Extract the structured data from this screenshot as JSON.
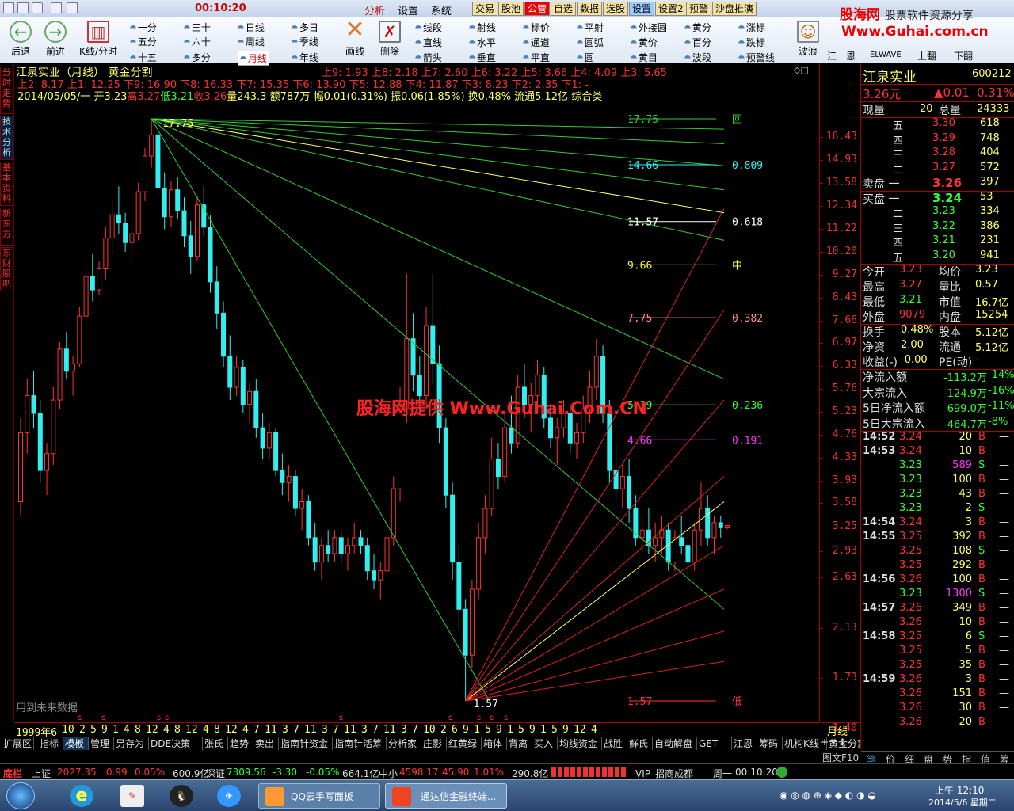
{
  "titlebar": {
    "time": "00:10:20",
    "menus": [
      "分析",
      "设置",
      "系统"
    ],
    "buttons": [
      "交易",
      "股池",
      "公管",
      "自选",
      "数据",
      "选股",
      "设置",
      "设置2",
      "预警",
      "沙盘推演"
    ]
  },
  "toolbar": {
    "nav": [
      "后退",
      "前进",
      "K线/分时"
    ],
    "periods": [
      [
        "一分",
        "三十",
        "日线",
        "多日"
      ],
      [
        "五分",
        "六十",
        "周线",
        "季线"
      ],
      [
        "十五",
        "多分",
        "月线",
        "年线"
      ]
    ],
    "draw_tools": [
      "画线",
      "删除"
    ],
    "shapes": [
      [
        "线段",
        "射线",
        "标价",
        "平射",
        "外接圆",
        "黄分",
        "涨标"
      ],
      [
        "直线",
        "水平",
        "通道",
        "圆弧",
        "黄价",
        "百分",
        "跌标"
      ],
      [
        "箭头",
        "垂直",
        "平直",
        "圆",
        "黄目",
        "波段",
        "预警线"
      ]
    ],
    "extra": [
      "波浪",
      "江",
      "恩",
      "ELWAVE",
      "上翻",
      "下翻"
    ]
  },
  "logo": {
    "line1": "股海网",
    "line1b": "股票软件资源分享",
    "line2": "Www.Guhai.com.cn"
  },
  "side_tabs": [
    "分时走势",
    "技术分析",
    "基本资料",
    "新东方",
    "东财股吧"
  ],
  "chart": {
    "title": "江泉实业（月线）  黄金分割",
    "line1": "上9: 1.93 上8: 2.18 上7: 2.60 上6: 3.22 上5: 3.66 上4: 4.09 上3: 5.65",
    "line2": "上2: 8.17 上1: 12.25 下9: 16.90 下8: 16.33 下7: 15.35 下6: 13.90 下5: 12.88 下4: 11.87 下3: 8.23 下2: 2.35 下1: -",
    "line3_date": "2014/05/05/一",
    "line3_open": "开3.23",
    "line3_high": "高3.27",
    "line3_low": "低3.21",
    "line3_close": "收3.26",
    "line3_vol": "量243.3",
    "line3_amt": "额787万",
    "line3_chg": "幅0.01(0.31%)",
    "line3_amp": "振0.06(1.85%)",
    "line3_turn": "换0.48%",
    "line3_float": "流通5.12亿",
    "line3_cat": "综合类",
    "top_label": "17.75",
    "low_label": "1.57",
    "fib": [
      {
        "price": "17.75",
        "ratio": "回",
        "color": "#3c3"
      },
      {
        "price": "14.66",
        "ratio": "0.809",
        "color": "#3ee"
      },
      {
        "price": "11.57",
        "ratio": "0.618",
        "color": "#fff"
      },
      {
        "price": "9.66",
        "ratio": "中",
        "color": "#ff3"
      },
      {
        "price": "7.75",
        "ratio": "0.382",
        "color": "#f88"
      },
      {
        "price": "5.39",
        "ratio": "0.236",
        "color": "#3f3"
      },
      {
        "price": "4.66",
        "ratio": "0.191",
        "color": "#f3f"
      },
      {
        "price": "1.57",
        "ratio": "低",
        "color": "#f33"
      }
    ],
    "future_note": "用到未来数据",
    "watermark": "股海网提供 Www.Guhai.Com.CN",
    "price_axis": [
      "16.43",
      "14.93",
      "13.58",
      "12.34",
      "11.22",
      "10.20",
      "9.27",
      "8.43",
      "7.66",
      "6.97",
      "6.33",
      "5.76",
      "5.23",
      "4.76",
      "4.33",
      "3.93",
      "3.58",
      "3.25",
      "2.93",
      "2.63",
      "2.13",
      "1.73",
      "1.40"
    ],
    "date_axis": [
      "1999年6",
      "10",
      "2",
      "5",
      "9",
      "1",
      "4",
      "8",
      "12",
      "4",
      "8",
      "12",
      "4",
      "8",
      "12",
      "4",
      "7",
      "11",
      "3",
      "7",
      "11",
      "3",
      "7",
      "11",
      "3",
      "7",
      "11",
      "3",
      "7",
      "10",
      "2",
      "6",
      "9",
      "1",
      "5",
      "9",
      "1",
      "5",
      "9",
      "1",
      "5",
      "9",
      "12",
      "4"
    ],
    "period_label": "月线",
    "candles": [
      [
        3.6,
        5.1,
        3.4,
        4.8
      ],
      [
        4.8,
        6.0,
        4.4,
        5.6
      ],
      [
        5.6,
        6.2,
        4.9,
        5.2
      ],
      [
        5.2,
        5.5,
        3.9,
        4.1
      ],
      [
        4.1,
        4.6,
        3.7,
        4.4
      ],
      [
        4.4,
        5.8,
        4.2,
        5.5
      ],
      [
        5.5,
        7.0,
        5.3,
        6.8
      ],
      [
        6.8,
        7.3,
        6.0,
        6.2
      ],
      [
        6.2,
        6.6,
        5.6,
        6.4
      ],
      [
        6.4,
        8.1,
        6.3,
        7.8
      ],
      [
        7.8,
        9.6,
        7.5,
        9.2
      ],
      [
        9.2,
        10.1,
        8.3,
        8.7
      ],
      [
        8.7,
        9.8,
        8.5,
        9.5
      ],
      [
        9.5,
        11.3,
        9.1,
        10.8
      ],
      [
        10.8,
        12.6,
        10.1,
        11.9
      ],
      [
        11.9,
        13.4,
        11.0,
        11.5
      ],
      [
        11.5,
        12.0,
        10.2,
        10.6
      ],
      [
        10.6,
        11.4,
        9.6,
        11.0
      ],
      [
        11.0,
        13.6,
        10.7,
        13.1
      ],
      [
        13.1,
        15.7,
        12.6,
        15.2
      ],
      [
        15.2,
        17.75,
        14.5,
        16.6
      ],
      [
        16.6,
        16.9,
        12.8,
        13.3
      ],
      [
        13.3,
        14.2,
        11.2,
        11.8
      ],
      [
        11.8,
        13.7,
        11.3,
        13.2
      ],
      [
        13.2,
        13.9,
        11.7,
        12.1
      ],
      [
        12.1,
        12.8,
        10.4,
        10.9
      ],
      [
        10.9,
        11.6,
        9.3,
        10.0
      ],
      [
        10.0,
        12.9,
        9.8,
        12.4
      ],
      [
        12.4,
        13.4,
        10.9,
        11.3
      ],
      [
        11.3,
        11.9,
        8.6,
        9.0
      ],
      [
        9.0,
        9.6,
        7.4,
        7.9
      ],
      [
        7.9,
        8.3,
        6.3,
        6.6
      ],
      [
        6.6,
        7.2,
        5.5,
        5.8
      ],
      [
        5.8,
        6.6,
        5.6,
        6.3
      ],
      [
        6.3,
        6.5,
        5.2,
        5.4
      ],
      [
        5.4,
        5.9,
        5.0,
        5.7
      ],
      [
        5.7,
        6.0,
        4.7,
        4.9
      ],
      [
        4.9,
        5.2,
        4.3,
        4.5
      ],
      [
        4.5,
        5.0,
        4.3,
        4.8
      ],
      [
        4.8,
        4.9,
        4.0,
        4.1
      ],
      [
        4.1,
        4.4,
        3.7,
        3.9
      ],
      [
        3.9,
        4.2,
        3.6,
        4.0
      ],
      [
        4.0,
        4.1,
        3.4,
        3.5
      ],
      [
        3.5,
        3.8,
        3.2,
        3.6
      ],
      [
        3.6,
        3.7,
        3.0,
        3.1
      ],
      [
        3.1,
        3.3,
        2.7,
        2.8
      ],
      [
        2.8,
        3.1,
        2.6,
        3.0
      ],
      [
        3.0,
        3.2,
        2.8,
        2.9
      ],
      [
        2.9,
        3.2,
        2.8,
        3.1
      ],
      [
        3.1,
        3.2,
        2.8,
        2.9
      ],
      [
        2.9,
        3.1,
        2.7,
        3.0
      ],
      [
        3.0,
        3.3,
        2.9,
        3.1
      ],
      [
        3.1,
        3.2,
        2.9,
        3.0
      ],
      [
        3.0,
        3.1,
        2.6,
        2.7
      ],
      [
        2.7,
        2.9,
        2.5,
        2.6
      ],
      [
        2.6,
        2.8,
        2.4,
        2.7
      ],
      [
        2.7,
        3.2,
        2.6,
        3.1
      ],
      [
        3.1,
        4.0,
        3.0,
        3.8
      ],
      [
        3.8,
        5.8,
        3.6,
        5.3
      ],
      [
        5.3,
        9.3,
        5.0,
        7.1
      ],
      [
        7.1,
        7.9,
        5.7,
        6.1
      ],
      [
        6.1,
        6.6,
        5.2,
        5.6
      ],
      [
        5.6,
        8.1,
        5.3,
        7.5
      ],
      [
        7.5,
        9.3,
        5.9,
        6.4
      ],
      [
        6.4,
        6.9,
        4.6,
        4.9
      ],
      [
        4.9,
        5.1,
        3.5,
        3.7
      ],
      [
        3.7,
        3.9,
        2.6,
        2.8
      ],
      [
        2.8,
        3.0,
        2.1,
        2.3
      ],
      [
        2.3,
        2.4,
        1.57,
        1.9
      ],
      [
        1.9,
        2.6,
        1.8,
        2.5
      ],
      [
        2.5,
        3.3,
        2.4,
        3.1
      ],
      [
        3.1,
        3.7,
        2.9,
        3.5
      ],
      [
        3.5,
        4.7,
        3.4,
        4.3
      ],
      [
        4.3,
        4.6,
        3.8,
        4.0
      ],
      [
        4.0,
        5.2,
        3.9,
        4.9
      ],
      [
        4.9,
        5.6,
        4.4,
        4.6
      ],
      [
        4.6,
        6.1,
        4.5,
        5.8
      ],
      [
        5.8,
        6.4,
        5.1,
        5.4
      ],
      [
        5.4,
        5.9,
        4.8,
        5.6
      ],
      [
        5.6,
        6.5,
        5.2,
        6.1
      ],
      [
        6.1,
        6.3,
        4.9,
        5.1
      ],
      [
        5.1,
        5.4,
        4.5,
        4.7
      ],
      [
        4.7,
        5.1,
        4.2,
        4.9
      ],
      [
        4.9,
        5.5,
        4.7,
        5.2
      ],
      [
        5.2,
        5.4,
        4.4,
        4.6
      ],
      [
        4.6,
        5.0,
        4.3,
        4.8
      ],
      [
        4.8,
        5.6,
        4.6,
        5.3
      ],
      [
        5.3,
        6.2,
        5.0,
        5.8
      ],
      [
        5.8,
        7.1,
        5.5,
        6.6
      ],
      [
        6.6,
        6.9,
        5.0,
        5.2
      ],
      [
        5.2,
        5.5,
        3.9,
        4.1
      ],
      [
        4.1,
        4.6,
        3.6,
        3.8
      ],
      [
        3.8,
        4.2,
        3.5,
        4.0
      ],
      [
        4.0,
        4.3,
        3.3,
        3.5
      ],
      [
        3.5,
        3.7,
        3.0,
        3.1
      ],
      [
        3.1,
        3.4,
        2.9,
        3.2
      ],
      [
        3.2,
        3.5,
        2.9,
        3.0
      ],
      [
        3.0,
        3.3,
        2.8,
        3.1
      ],
      [
        3.1,
        3.4,
        2.9,
        3.2
      ],
      [
        3.2,
        3.3,
        2.7,
        2.8
      ],
      [
        2.8,
        3.2,
        2.7,
        3.1
      ],
      [
        3.1,
        3.4,
        2.9,
        3.0
      ],
      [
        3.0,
        3.2,
        2.6,
        2.8
      ],
      [
        2.8,
        3.3,
        2.7,
        3.2
      ],
      [
        3.2,
        3.9,
        3.0,
        3.5
      ],
      [
        3.5,
        3.7,
        3.0,
        3.1
      ],
      [
        3.1,
        3.4,
        2.9,
        3.3
      ],
      [
        3.3,
        3.4,
        3.1,
        3.23
      ],
      [
        3.23,
        3.27,
        3.21,
        3.26
      ]
    ]
  },
  "bottom_tabs": [
    "指标",
    "模板",
    "管理",
    "另存为",
    "DDE决策",
    "张氏",
    "趋势",
    "卖出",
    "指南针资金",
    "指南针活筹",
    "分析家",
    "庄影",
    "红黄绿",
    "箱体",
    "背离",
    "买入",
    "均线资金",
    "战胜",
    "鲜氏",
    "自动解盘",
    "GET",
    "江恩",
    "筹码",
    "机构K线",
    "黄金分割"
  ],
  "quote": {
    "name": "江泉实业",
    "code": "600212",
    "price": "3.26元",
    "change": "▲0.01",
    "pct": "0.31%",
    "now_label": "现量",
    "now": "20",
    "total_label": "总量",
    "total": "24333",
    "asks": [
      [
        "五",
        "3.30",
        "618"
      ],
      [
        "四",
        "3.29",
        "748"
      ],
      [
        "三",
        "3.28",
        "404"
      ],
      [
        "二",
        "3.27",
        "572"
      ],
      [
        "卖盘 一",
        "3.26",
        "397"
      ]
    ],
    "bids": [
      [
        "买盘 一",
        "3.24",
        "53"
      ],
      [
        "二",
        "3.23",
        "334"
      ],
      [
        "三",
        "3.22",
        "386"
      ],
      [
        "四",
        "3.21",
        "231"
      ],
      [
        "五",
        "3.20",
        "941"
      ]
    ],
    "stats": [
      [
        "今开",
        "3.23",
        "均价",
        "3.23"
      ],
      [
        "最高",
        "3.27",
        "量比",
        "0.57"
      ],
      [
        "最低",
        "3.21",
        "市值",
        "16.7亿"
      ],
      [
        "外盘",
        "9079",
        "内盘",
        "15254"
      ]
    ],
    "stats2": [
      [
        "换手",
        "0.48%",
        "股本",
        "5.12亿"
      ],
      [
        "净资",
        "2.00",
        "流通",
        "5.12亿"
      ],
      [
        "收益(-)",
        "-0.00",
        "PE(动)",
        "-"
      ]
    ],
    "flows": [
      [
        "净流入额",
        "-113.2万",
        "-14%"
      ],
      [
        "大宗流入",
        "-124.9万",
        "-16%"
      ],
      [
        "5日净流入额",
        "-699.0万",
        "-11%"
      ],
      [
        "5日大宗流入",
        "-464.7万",
        "-8%"
      ]
    ],
    "ticks": [
      [
        "14:52",
        "3.24",
        "20",
        "B"
      ],
      [
        "14:53",
        "3.24",
        "10",
        "B"
      ],
      [
        "",
        "3.23",
        "589",
        "S"
      ],
      [
        "",
        "3.23",
        "100",
        "B"
      ],
      [
        "",
        "3.23",
        "43",
        "B"
      ],
      [
        "",
        "3.23",
        "2",
        "S"
      ],
      [
        "14:54",
        "3.24",
        "3",
        "B"
      ],
      [
        "14:55",
        "3.25",
        "392",
        "B"
      ],
      [
        "",
        "3.25",
        "108",
        "S"
      ],
      [
        "",
        "3.25",
        "292",
        "B"
      ],
      [
        "14:56",
        "3.26",
        "100",
        "B"
      ],
      [
        "",
        "3.23",
        "1300",
        "S"
      ],
      [
        "14:57",
        "3.26",
        "349",
        "B"
      ],
      [
        "",
        "3.26",
        "10",
        "B"
      ],
      [
        "14:58",
        "3.25",
        "6",
        "S"
      ],
      [
        "",
        "3.25",
        "5",
        "B"
      ],
      [
        "",
        "3.25",
        "35",
        "B"
      ],
      [
        "14:59",
        "3.26",
        "3",
        "B"
      ],
      [
        "",
        "3.26",
        "151",
        "B"
      ],
      [
        "",
        "3.26",
        "30",
        "B"
      ],
      [
        "",
        "3.26",
        "20",
        "B"
      ]
    ],
    "tabs": [
      "笔",
      "价",
      "细",
      "盘",
      "势",
      "指",
      "值",
      "筹"
    ],
    "fig_label": "图文F10"
  },
  "statusbar": {
    "label": "底栏",
    "sh_name": "上证",
    "sh": "2027.35",
    "sh_chg": "0.99",
    "sh_pct": "0.05%",
    "sh_amt": "600.9亿",
    "sz_name": "深证",
    "sz": "7309.56",
    "sz_chg": "-3.30",
    "sz_pct": "-0.05%",
    "sz_amt": "664.1亿",
    "zx_name": "中小",
    "zx": "4598.17",
    "zx_chg": "45.90",
    "zx_pct": "1.01%",
    "zx_amt": "290.8亿",
    "vip": "VIP_招商成都",
    "day": "周一",
    "time": "00:10:20"
  },
  "taskbar": {
    "app1": "QQ云手写面板",
    "app2": "通达信金融终端...",
    "clock": "上午 12:10",
    "date": "2014/5/6 星期二"
  }
}
